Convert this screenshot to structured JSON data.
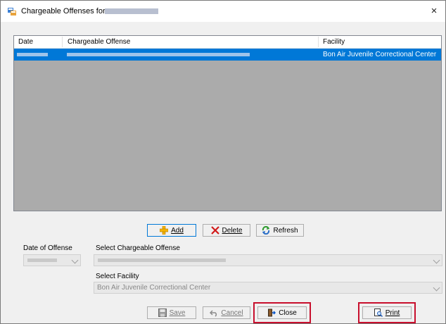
{
  "window": {
    "title": "Chargeable Offenses for",
    "close_glyph": "×"
  },
  "list": {
    "columns": [
      "Date",
      "Chargeable Offense",
      "Facility"
    ],
    "rows": [
      {
        "facility": "Bon Air Juvenile Correctional Center",
        "selected": true
      }
    ]
  },
  "buttons": {
    "add": "Add",
    "delete": "Delete",
    "refresh": "Refresh",
    "save": "Save",
    "cancel": "Cancel",
    "close": "Close",
    "print": "Print"
  },
  "form": {
    "date_label": "Date of Offense",
    "offense_label": "Select Chargeable Offense",
    "facility_label": "Select Facility",
    "facility_value": "Bon Air Juvenile Correctional Center"
  },
  "colors": {
    "selection": "#0078d7",
    "highlight": "#c80f2d"
  }
}
